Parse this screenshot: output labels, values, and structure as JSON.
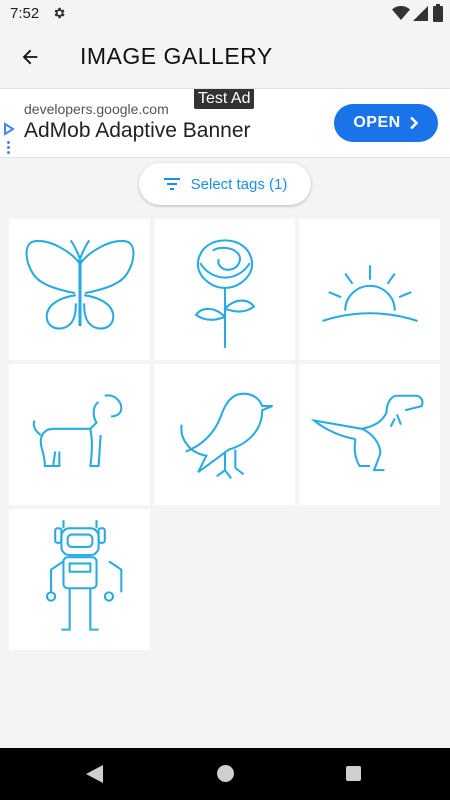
{
  "status_bar": {
    "time": "7:52",
    "icons": [
      "gear-icon",
      "wifi-icon",
      "signal-icon",
      "battery-icon"
    ]
  },
  "app_bar": {
    "title": "IMAGE GALLERY",
    "back_icon": "arrow-back-icon"
  },
  "ad": {
    "tag": "Test Ad",
    "domain": "developers.google.com",
    "headline": "AdMob Adaptive Banner",
    "cta": "OPEN",
    "accent": "#1a73e8"
  },
  "filter": {
    "label": "Select tags (1)",
    "icon": "filter-list-icon",
    "color": "#1a8fe3"
  },
  "gallery": {
    "stroke_color": "#29abe2",
    "items": [
      {
        "name": "butterfly"
      },
      {
        "name": "rose"
      },
      {
        "name": "sunrise"
      },
      {
        "name": "dog"
      },
      {
        "name": "bird"
      },
      {
        "name": "dinosaur"
      },
      {
        "name": "robot"
      }
    ]
  },
  "nav_bar": {
    "icons": [
      "nav-back-icon",
      "nav-home-icon",
      "nav-recents-icon"
    ]
  }
}
